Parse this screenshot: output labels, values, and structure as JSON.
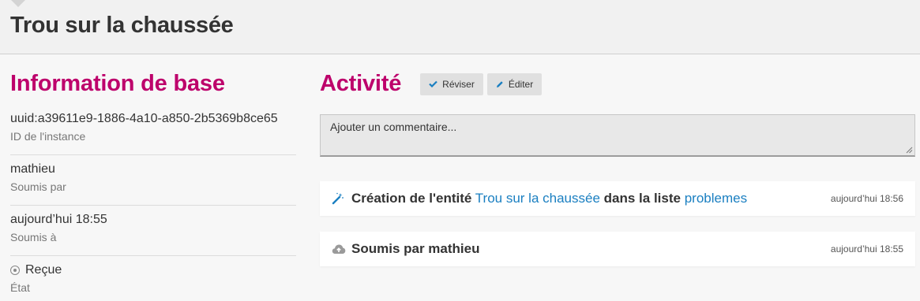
{
  "header": {
    "title": "Trou sur la chaussée"
  },
  "basic_info": {
    "heading": "Information de base",
    "items": [
      {
        "value": "uuid:a39611e9-1886-4a10-a850-2b5369b8ce65",
        "label": "ID de l'instance"
      },
      {
        "value": "mathieu",
        "label": "Soumis par"
      },
      {
        "value": "aujourd’hui 18:55",
        "label": "Soumis à"
      },
      {
        "value": "Reçue",
        "label": "État",
        "icon": "radio-dot-icon"
      }
    ]
  },
  "activity": {
    "heading": "Activité",
    "review_button": {
      "label": "Réviser",
      "icon": "check-icon"
    },
    "edit_button": {
      "label": "Éditer",
      "icon": "pencil-icon"
    },
    "comment_placeholder": "Ajouter un commentaire...",
    "feed": [
      {
        "icon": "magic-wand-icon",
        "prefix": "Création de l'entité",
        "entity_link": "Trou sur la chaussée",
        "middle": "dans la liste",
        "list_link": "problemes",
        "time": "aujourd’hui 18:56"
      },
      {
        "icon": "cloud-upload-icon",
        "text": "Soumis par mathieu",
        "time": "aujourd’hui 18:55"
      }
    ]
  },
  "colors": {
    "heading_accent": "#bd006b",
    "link": "#1a7fc1",
    "icon_blue": "#1a7fc1"
  }
}
